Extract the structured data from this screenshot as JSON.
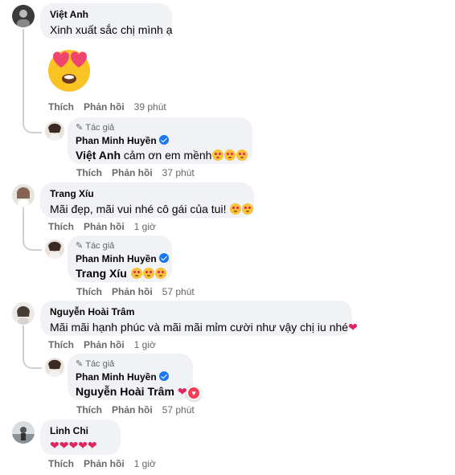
{
  "actions": {
    "like": "Thích",
    "reply": "Phản hồi"
  },
  "author_tag": "Tác giả",
  "comments": [
    {
      "name": "Việt Anh",
      "text": "Xinh xuất sắc chị mình ạ",
      "time": "39 phút",
      "reply": {
        "name": "Phan Minh Huyền",
        "mention": "Việt Anh",
        "text": " cảm ơn em mềnh",
        "time": "37 phút"
      }
    },
    {
      "name": "Trang Xíu",
      "text": "Mãi đẹp, mãi vui nhé cô gái của tui!",
      "time": "1 giờ",
      "reply": {
        "name": "Phan Minh Huyền",
        "mention": "Trang Xíu",
        "text": "",
        "time": "57 phút"
      }
    },
    {
      "name": "Nguyễn Hoài Trâm",
      "text": "Mãi mãi hạnh phúc và mãi mãi mỉm cười như vậy chị iu nhé",
      "time": "1 giờ",
      "reply": {
        "name": "Phan Minh Huyền",
        "mention": "Nguyễn Hoài Trâm",
        "text": "",
        "time": "57 phút"
      }
    },
    {
      "name": "Linh Chi",
      "text": "",
      "time": "1 giờ"
    }
  ],
  "colors": {
    "bubble": "#f0f2f5",
    "verified": "#1877f2",
    "meta": "#65676b",
    "heart": "#e0245e"
  }
}
